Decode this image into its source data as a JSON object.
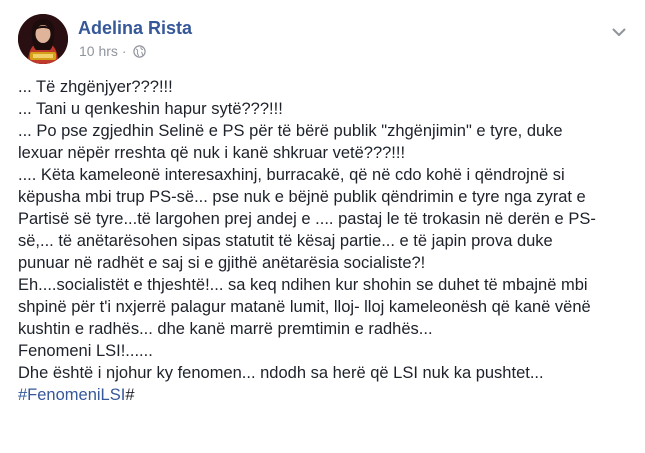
{
  "post": {
    "author": "Adelina Rista",
    "timestamp": "10 hrs",
    "separator": "·",
    "privacy_icon": "globe-icon",
    "more_icon": "more-options-chevron-icon",
    "lines": [
      "... Të zhgënjyer???!!!",
      "... Tani u qenkeshin hapur sytë???!!!",
      "... Po pse zgjedhin Selinë e PS për të bërë publik \"zhgënjimin\" e tyre, duke",
      "lexuar nëpër rreshta që nuk i kanë shkruar vetë???!!!",
      ".... Këta kameleonë interesaxhinj, burracakë, që në cdo kohë i qëndrojnë si",
      "këpusha mbi trup PS-së... pse nuk e bëjnë publik qëndrimin e tyre nga zyrat e",
      "Partisë së tyre...të largohen prej andej e .... pastaj le të trokasin në derën e PS-",
      "së,... të anëtarësohen sipas statutit të kësaj partie... e të japin prova duke",
      "punuar në radhët e saj si e gjithë anëtarësia socialiste?!",
      "Eh....socialistët e thjeshtë!... sa keq ndihen kur shohin se duhet të mbajnë mbi",
      "shpinë për t'i nxjerrë palagur matanë lumit, lloj- lloj kameleonësh që kanë vënë",
      "kushtin e radhës... dhe kanë marrë premtimin e radhës...",
      "Fenomeni LSI!......",
      "Dhe është i njohur ky fenomen... ndodh sa herë që LSI nuk ka pushtet..."
    ],
    "hashtag": "#FenomeniLSI",
    "hashtag_suffix": "#",
    "colors": {
      "author": "#365899",
      "meta": "#90949c",
      "text": "#1d2129",
      "hashtag": "#365899"
    }
  }
}
